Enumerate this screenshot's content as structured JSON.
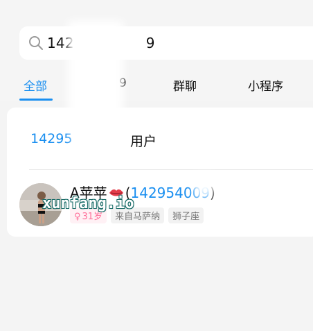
{
  "search": {
    "query": "142",
    "query_suffix": "9"
  },
  "tabs": [
    {
      "label": "全部"
    },
    {
      "label": "9"
    },
    {
      "label": "群聊"
    },
    {
      "label": "小程序"
    }
  ],
  "results": {
    "search_user": {
      "number_prefix": "14295",
      "suffix": "用户"
    },
    "contact": {
      "name": "A苹苹",
      "open_paren": "(",
      "number": "14295400",
      "number_tail": "9",
      "close_paren": ")",
      "tags": [
        {
          "type": "gender",
          "symbol": "♀",
          "label": "31岁"
        },
        {
          "type": "location",
          "label": "来自马萨纳"
        },
        {
          "type": "zodiac",
          "label": "狮子座"
        }
      ]
    }
  },
  "watermark": {
    "text": "xunfang.io"
  },
  "colors": {
    "accent": "#1a8ff0",
    "gender_badge_text": "#ff6e99",
    "gender_badge_bg": "#fff1f5"
  }
}
